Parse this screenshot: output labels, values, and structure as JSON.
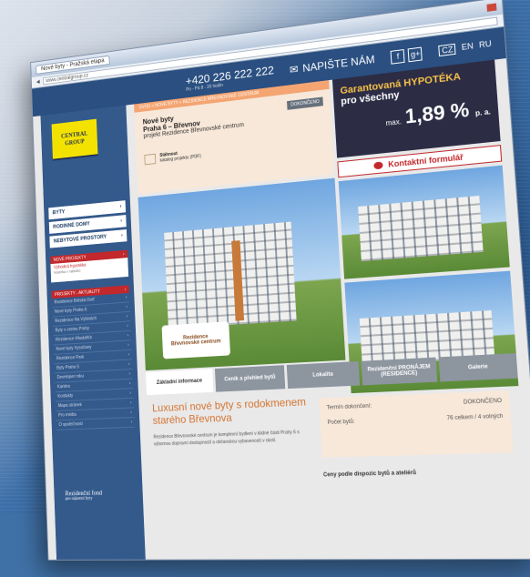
{
  "browser": {
    "tab": "Nové byty - Pražská etapa",
    "address": "www.centralgroup.cz"
  },
  "header": {
    "phone": "+420 226 222 222",
    "phone_sub": "Po - Pá 8 - 20 hodin",
    "write_label": "NAPIŠTE NÁM",
    "social": [
      "f",
      "g+"
    ],
    "languages": [
      "CZ",
      "EN",
      "RU"
    ]
  },
  "logo": {
    "line1": "CENTRAL",
    "line2": "GROUP"
  },
  "nav": {
    "items": [
      "BYTY",
      "RODINNÉ DOMY",
      "NEBYTOVÉ PROSTORY"
    ],
    "news_title": "NOVÉ PROJEKTY",
    "news_text": "Výhodná hypotéka",
    "news_sub": "Novinka v nabídce",
    "news_badge": "NOVÉ",
    "section_title": "PROJEKTY - AKTUALITY",
    "sub_items": [
      "Rezidence Britská čtvrť",
      "Nové byty Praha 6",
      "Rezidence Na Výšinách",
      "Byty v centru Prahy",
      "Rezidence Hloubětín",
      "Nové byty Vysočany",
      "Rezidence Park",
      "Byty Praha 5",
      "Developer roku",
      "Kariéra",
      "Kontakty",
      "Mapa stránek",
      "Pro média",
      "O společnosti"
    ]
  },
  "bottom_logo": {
    "name": "Rezidenční fond",
    "sub": "pro nájemní byty"
  },
  "breadcrumb": "ÚVOD » NOVÉ BYTY » REZIDENCE BŘEVNOVSKÉ CENTRUM",
  "intro": {
    "title": "Nové byty",
    "subtitle": "Praha 6 – Břevnov",
    "text": "projekt Rezidence Břevnovské centrum",
    "badge": "DOKONČENO",
    "download": "Stáhnout",
    "download_sub": "katalog projektu (PDF)"
  },
  "promo": {
    "line1": "Garantovaná HYPOTÉKA",
    "line2": "pro všechny",
    "max_label": "max.",
    "rate": "1,89 %",
    "rate_suffix": "p. a."
  },
  "contact_label": "Kontaktní formulář",
  "sticker": {
    "line1": "Rezidence",
    "line2": "Břevnovské centrum"
  },
  "tabs": [
    "Základní informace",
    "Ceník a přehled bytů",
    "Lokalita",
    "Rezidenční PRONÁJEM (RESIDENCE)",
    "Galerie"
  ],
  "article": {
    "heading": "Luxusní nové byty s rodokmenem starého Břevnova",
    "body": "Rezidence Břevnovské centrum je komplexní bydlení v klidné části Prahy 6 s výbornou dopravní dostupností a občanskou vybaveností v okolí."
  },
  "info_table": {
    "rows": [
      {
        "label": "Termín dokončení:",
        "value": "DOKONČENO"
      },
      {
        "label": "Počet bytů:",
        "value": "76 celkem / 4 volných"
      }
    ]
  },
  "prices_title": "Ceny podle dispozic bytů a ateliérů"
}
